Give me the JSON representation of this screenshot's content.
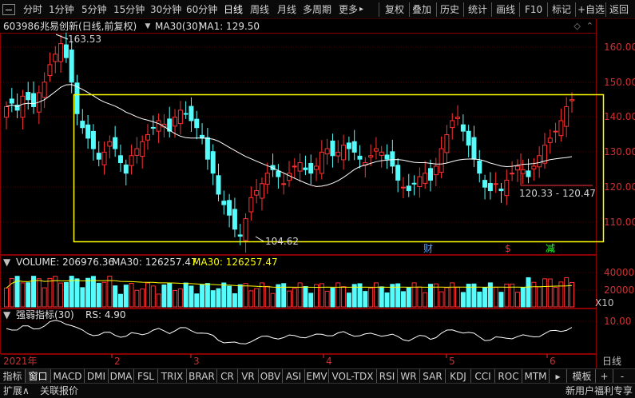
{
  "toolbar": {
    "periods": [
      "分时",
      "1分钟",
      "5分钟",
      "15分钟",
      "30分钟",
      "60分钟",
      "日线",
      "周线",
      "月线",
      "多周期",
      "更多"
    ],
    "active_period": "日线",
    "more_arrow": "▸",
    "actions": [
      "复权",
      "叠加",
      "历史",
      "统计",
      "画线",
      "F10",
      "标记",
      "+自选",
      "返回"
    ]
  },
  "title": {
    "code": "603986",
    "name_mode": "兆易创新(日线,前复权)",
    "ma_label": "MA30(30)",
    "ma_value": "MA1: 129.50"
  },
  "price_axis": [
    "160.00",
    "150.00",
    "140.00",
    "130.00",
    "120.00",
    "110.00"
  ],
  "annotations": {
    "high": "163.53",
    "low": "104.62",
    "range": "120.33 - 120.47",
    "markers": [
      "财",
      "$",
      "减"
    ]
  },
  "volume": {
    "label": "VOLUME: 206976.36",
    "ma": "MA30: 126257.47",
    "ma_yellow": "MA30: 126257.47",
    "axis": [
      "40000",
      "20000"
    ],
    "unit": "X10"
  },
  "rs": {
    "label": "强弱指标(30)",
    "value": "RS: 4.90",
    "axis": "10.00"
  },
  "date_axis": [
    "2021年",
    "2",
    "3",
    "4",
    "5",
    "6"
  ],
  "date_axis_right": "日线",
  "tabs": [
    "指标",
    "窗口",
    "MACD",
    "DMI",
    "DMA",
    "FSL",
    "TRIX",
    "BRAR",
    "CR",
    "VR",
    "OBV",
    "ASI",
    "EMV",
    "VOL-TDX",
    "RSI",
    "WR",
    "SAR",
    "KDJ",
    "CCI",
    "ROC",
    "MTM"
  ],
  "tab_right": [
    "模板",
    "+",
    "-"
  ],
  "status": {
    "left1": "扩展∧",
    "left2": "关联报价",
    "right": "新用户福利专享"
  },
  "colors": {
    "up": "#ff3232",
    "down": "#54fcfc",
    "ma": "#ffffff",
    "box": "#ffff00",
    "grid": "#5a0000"
  }
}
